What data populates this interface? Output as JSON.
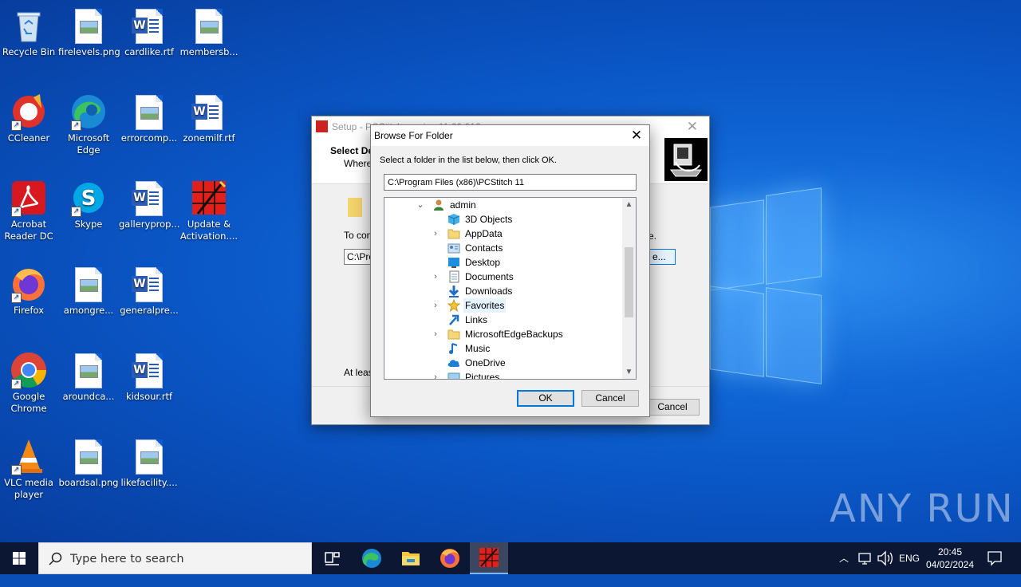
{
  "desktop": {
    "icons": [
      {
        "label": "Recycle Bin"
      },
      {
        "label": "firelevels.png"
      },
      {
        "label": "cardlike.rtf"
      },
      {
        "label": "membersb..."
      },
      {
        "label": "CCleaner"
      },
      {
        "label": "Microsoft Edge"
      },
      {
        "label": "errorcomp..."
      },
      {
        "label": "zonemilf.rtf"
      },
      {
        "label": "Acrobat Reader DC"
      },
      {
        "label": "Skype"
      },
      {
        "label": "galleryprop..."
      },
      {
        "label": "Update & Activation...."
      },
      {
        "label": "Firefox"
      },
      {
        "label": "amongre..."
      },
      {
        "label": "generalpre..."
      },
      {
        "label": "Google Chrome"
      },
      {
        "label": "aroundca..."
      },
      {
        "label": "kidsour.rtf"
      },
      {
        "label": "VLC media player"
      },
      {
        "label": "boardsal.png"
      },
      {
        "label": "likefacility...."
      }
    ],
    "watermark": "ANY RUN"
  },
  "setup": {
    "title": "Setup - PCStitch version 11.00.016",
    "heading": "Select De",
    "subheading": "Where",
    "continue_text": "To cont",
    "path_value": "C:\\Pro",
    "browse_label": "e...",
    "dot_text": "e.",
    "space_text": "At least",
    "cancel_label": "Cancel"
  },
  "browse": {
    "title": "Browse For Folder",
    "instruction": "Select a folder in the list below, then click OK.",
    "path": "C:\\Program Files (x86)\\PCStitch 11",
    "tree": [
      {
        "label": "admin",
        "expanded": true,
        "icon": "user-folder-icon"
      },
      {
        "label": "3D Objects",
        "expandable": false,
        "icon": "3d-objects-icon"
      },
      {
        "label": "AppData",
        "expandable": true,
        "icon": "folder-icon"
      },
      {
        "label": "Contacts",
        "expandable": false,
        "icon": "contacts-icon"
      },
      {
        "label": "Desktop",
        "expandable": false,
        "icon": "desktop-icon"
      },
      {
        "label": "Documents",
        "expandable": true,
        "icon": "documents-icon"
      },
      {
        "label": "Downloads",
        "expandable": false,
        "icon": "downloads-icon"
      },
      {
        "label": "Favorites",
        "expandable": true,
        "icon": "star-icon"
      },
      {
        "label": "Links",
        "expandable": false,
        "icon": "links-icon"
      },
      {
        "label": "MicrosoftEdgeBackups",
        "expandable": true,
        "icon": "folder-icon"
      },
      {
        "label": "Music",
        "expandable": false,
        "icon": "music-icon"
      },
      {
        "label": "OneDrive",
        "expandable": false,
        "icon": "onedrive-icon"
      },
      {
        "label": "Pictures",
        "expandable": true,
        "icon": "pictures-icon"
      }
    ],
    "ok_label": "OK",
    "cancel_label": "Cancel"
  },
  "taskbar": {
    "search_placeholder": "Type here to search",
    "language": "ENG",
    "time": "20:45",
    "date": "04/02/2024"
  }
}
